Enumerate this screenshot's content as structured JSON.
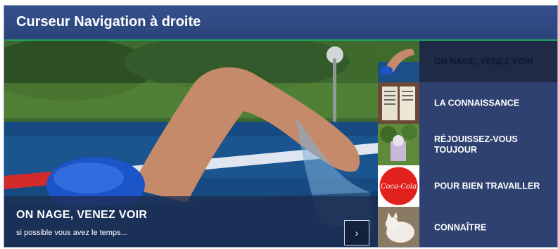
{
  "header": {
    "title": "Curseur Navigation à droite"
  },
  "hero": {
    "title": "ON NAGE, VENEZ VOIR",
    "subtitle": "si possible vous avez le temps...",
    "next_icon": "›"
  },
  "list": {
    "items": [
      {
        "label": "ON NAGE, VENEZ VOIR",
        "active": true
      },
      {
        "label": "LA CONNAISSANCE",
        "active": false
      },
      {
        "label": "RÉJOUISSEZ-VOUS TOUJOUR",
        "active": false
      },
      {
        "label": "POUR BIEN TRAVAILLER",
        "active": false,
        "logo_text": "Coca-Cola"
      },
      {
        "label": "CONNAÎTRE",
        "active": false
      }
    ]
  },
  "colors": {
    "header_bg": "#34508c",
    "accent_line": "#1fa35a",
    "panel_bg": "#2e4170",
    "active_bg": "#1e2a46"
  }
}
